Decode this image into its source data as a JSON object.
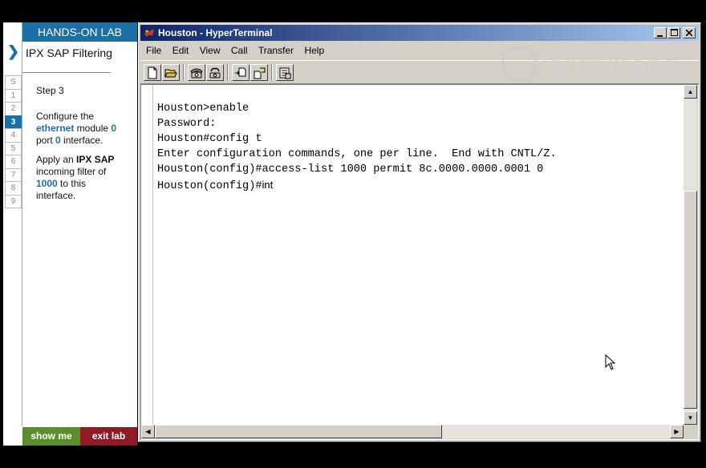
{
  "lab": {
    "header": "HANDS-ON LAB",
    "title": "IPX SAP Filtering",
    "steps": [
      "S",
      "1",
      "2",
      "3",
      "4",
      "5",
      "6",
      "7",
      "8",
      "9"
    ],
    "active_step": "3",
    "step_label": "Step 3",
    "instruction1": {
      "a": "Configure the",
      "b": "ethernet",
      "c": " module ",
      "d": "0",
      "e": "port ",
      "f": "0",
      "g": " interface."
    },
    "instruction2": {
      "a": "Apply an ",
      "b": "IPX SAP",
      "c": "incoming filter of",
      "d": "1000",
      "e": " to this",
      "f": "interface."
    },
    "show_me": "show me",
    "exit_lab": "exit lab",
    "accent_color": "#1d6fa5"
  },
  "window": {
    "title": "Houston - HyperTerminal",
    "menu": [
      "File",
      "Edit",
      "View",
      "Call",
      "Transfer",
      "Help"
    ],
    "terminal_lines": [
      "Houston>enable",
      "Password:",
      "Houston#config t",
      "Enter configuration commands, one per line.  End with CNTL/Z.",
      "Houston(config)#access-list 1000 permit 8c.0000.0000.0001 0"
    ],
    "current_prompt": "Houston(config)#",
    "current_input": "int"
  },
  "watermark": "uantrimang"
}
